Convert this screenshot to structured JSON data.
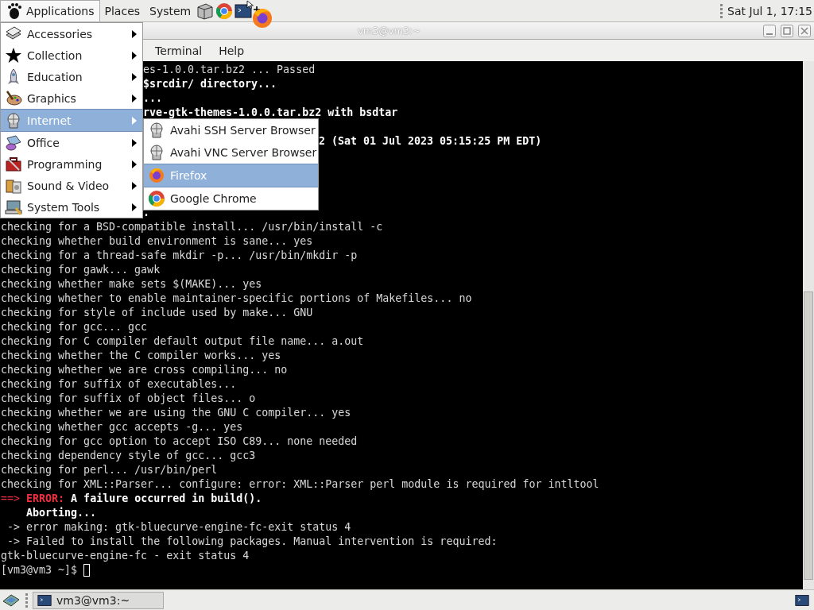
{
  "top_panel": {
    "menus": [
      {
        "label": "Applications",
        "selected": true
      },
      {
        "label": "Places",
        "selected": false
      },
      {
        "label": "System",
        "selected": false
      }
    ],
    "clock": "Sat Jul 1, 17:15"
  },
  "window": {
    "title": "vm3@vm3:~",
    "menu": [
      "Terminal",
      "Help"
    ]
  },
  "terminal": {
    "beside_menu_top": [
      {
        "parts": [
          {
            "text": "es-1.0.0.tar.bz2 ... Passed",
            "kind": "normal"
          }
        ]
      },
      {
        "parts": [
          {
            "text": "$srcdir/ directory...",
            "kind": "bold"
          }
        ]
      },
      {
        "parts": [
          {
            "text": "...",
            "kind": "bold"
          }
        ]
      },
      {
        "parts": [
          {
            "text": "rve-gtk-themes-1.0.0.tar.bz2 with bsdtar",
            "kind": "bold"
          }
        ]
      }
    ],
    "beside_submenu": [
      {
        "parts": [
          {
            "text": "2 (Sat 01 Jul 2023 05:15:25 PM EDT)",
            "kind": "bold"
          }
        ]
      }
    ],
    "beside_menu_bottom": [
      {
        "parts": [
          {
            "text": ".",
            "kind": "bold"
          }
        ]
      }
    ],
    "lines": [
      {
        "parts": [
          {
            "text": "checking for a BSD-compatible install... /usr/bin/install -c",
            "kind": "normal"
          }
        ]
      },
      {
        "parts": [
          {
            "text": "checking whether build environment is sane... yes",
            "kind": "normal"
          }
        ]
      },
      {
        "parts": [
          {
            "text": "checking for a thread-safe mkdir -p... /usr/bin/mkdir -p",
            "kind": "normal"
          }
        ]
      },
      {
        "parts": [
          {
            "text": "checking for gawk... gawk",
            "kind": "normal"
          }
        ]
      },
      {
        "parts": [
          {
            "text": "checking whether make sets $(MAKE)... yes",
            "kind": "normal"
          }
        ]
      },
      {
        "parts": [
          {
            "text": "checking whether to enable maintainer-specific portions of Makefiles... no",
            "kind": "normal"
          }
        ]
      },
      {
        "parts": [
          {
            "text": "checking for style of include used by make... GNU",
            "kind": "normal"
          }
        ]
      },
      {
        "parts": [
          {
            "text": "checking for gcc... gcc",
            "kind": "normal"
          }
        ]
      },
      {
        "parts": [
          {
            "text": "checking for C compiler default output file name... a.out",
            "kind": "normal"
          }
        ]
      },
      {
        "parts": [
          {
            "text": "checking whether the C compiler works... yes",
            "kind": "normal"
          }
        ]
      },
      {
        "parts": [
          {
            "text": "checking whether we are cross compiling... no",
            "kind": "normal"
          }
        ]
      },
      {
        "parts": [
          {
            "text": "checking for suffix of executables...",
            "kind": "normal"
          }
        ]
      },
      {
        "parts": [
          {
            "text": "checking for suffix of object files... o",
            "kind": "normal"
          }
        ]
      },
      {
        "parts": [
          {
            "text": "checking whether we are using the GNU C compiler... yes",
            "kind": "normal"
          }
        ]
      },
      {
        "parts": [
          {
            "text": "checking whether gcc accepts -g... yes",
            "kind": "normal"
          }
        ]
      },
      {
        "parts": [
          {
            "text": "checking for gcc option to accept ISO C89... none needed",
            "kind": "normal"
          }
        ]
      },
      {
        "parts": [
          {
            "text": "checking dependency style of gcc... gcc3",
            "kind": "normal"
          }
        ]
      },
      {
        "parts": [
          {
            "text": "checking for perl... /usr/bin/perl",
            "kind": "normal"
          }
        ]
      },
      {
        "parts": [
          {
            "text": "checking for XML::Parser... configure: error: XML::Parser perl module is required for intltool",
            "kind": "normal"
          }
        ]
      },
      {
        "parts": [
          {
            "text": "==>",
            "kind": "error"
          },
          {
            "text": "ERROR:",
            "kind": "error_bold"
          },
          {
            "text": "A failure occurred in build().",
            "kind": "bold"
          }
        ]
      },
      {
        "parts": [
          {
            "text": "    Aborting...",
            "kind": "bold"
          }
        ]
      },
      {
        "parts": [
          {
            "text": " -> error making: gtk-bluecurve-engine-fc-exit status 4",
            "kind": "normal"
          }
        ]
      },
      {
        "parts": [
          {
            "text": " -> Failed to install the following packages. Manual intervention is required:",
            "kind": "normal"
          }
        ]
      },
      {
        "parts": [
          {
            "text": "gtk-bluecurve-engine-fc - exit status 4",
            "kind": "normal"
          }
        ]
      },
      {
        "parts": [
          {
            "text": "[vm3@vm3 ~]$",
            "kind": "normal"
          }
        ],
        "cursor": true
      }
    ]
  },
  "applications_menu": {
    "items": [
      {
        "label": "Accessories",
        "selected": false
      },
      {
        "label": "Collection",
        "selected": false
      },
      {
        "label": "Education",
        "selected": false
      },
      {
        "label": "Graphics",
        "selected": false
      },
      {
        "label": "Internet",
        "selected": true
      },
      {
        "label": "Office",
        "selected": false
      },
      {
        "label": "Programming",
        "selected": false
      },
      {
        "label": "Sound & Video",
        "selected": false
      },
      {
        "label": "System Tools",
        "selected": false
      }
    ]
  },
  "submenu": {
    "items": [
      {
        "label": "Avahi SSH Server Browser",
        "selected": false
      },
      {
        "label": "Avahi VNC Server Browser",
        "selected": false
      },
      {
        "label": "Firefox",
        "selected": true
      },
      {
        "label": "Google Chrome",
        "selected": false
      }
    ]
  },
  "taskbar": {
    "tasks": [
      {
        "label": "vm3@vm3:~"
      }
    ]
  }
}
